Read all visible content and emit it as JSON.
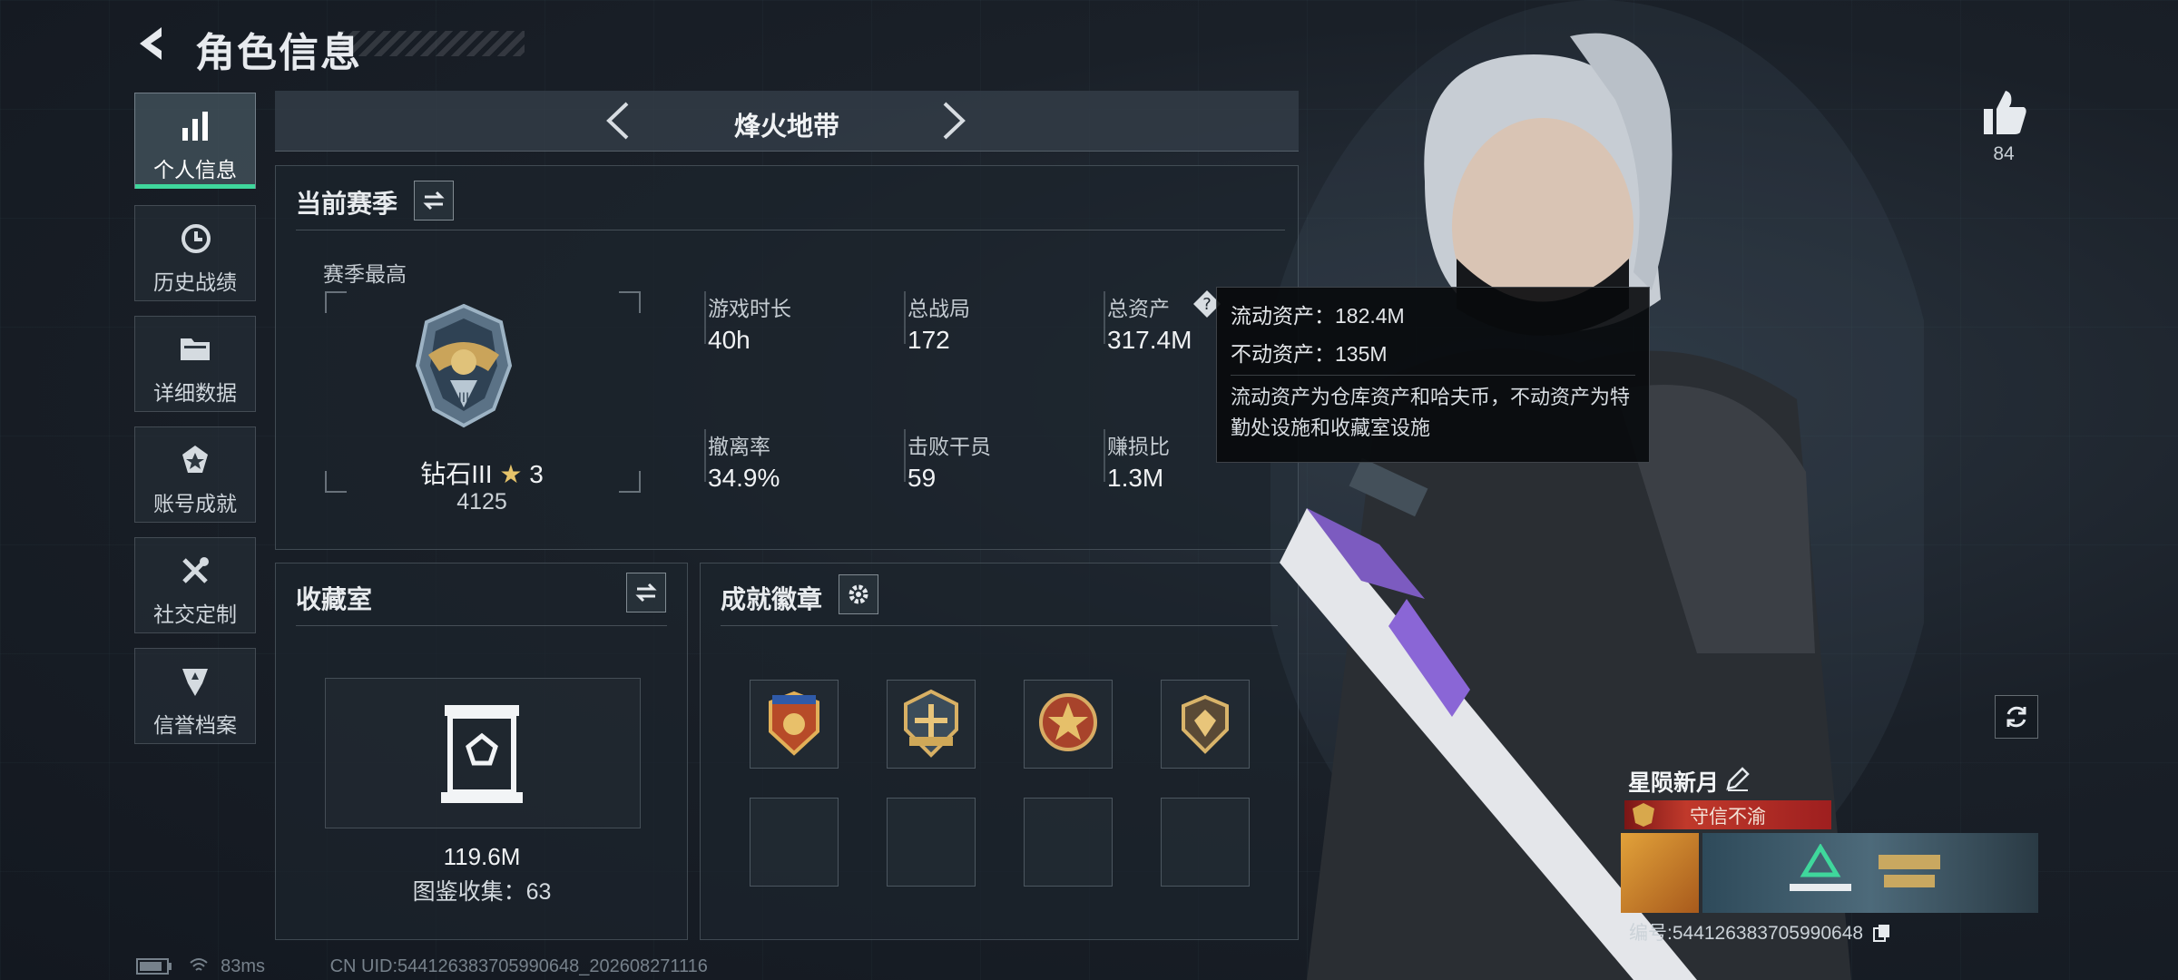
{
  "header": {
    "title": "角色信息"
  },
  "sidebar": {
    "items": [
      {
        "label": "个人信息",
        "active": true,
        "icon": "bar-chart-icon"
      },
      {
        "label": "历史战绩",
        "icon": "history-clock-icon"
      },
      {
        "label": "详细数据",
        "icon": "folder-icon"
      },
      {
        "label": "账号成就",
        "icon": "achievement-medal-icon"
      },
      {
        "label": "社交定制",
        "icon": "tools-icon"
      },
      {
        "label": "信誉档案",
        "icon": "shield-star-icon"
      }
    ]
  },
  "mode": {
    "title": "烽火地带"
  },
  "season": {
    "title": "当前赛季",
    "best_label": "赛季最高",
    "rank_name": "钻石III",
    "rank_stars": "3",
    "rank_score": "4125",
    "stats": [
      {
        "label": "游戏时长",
        "value": "40h"
      },
      {
        "label": "总战局",
        "value": "172"
      },
      {
        "label": "总资产",
        "value": "317.4M"
      },
      {
        "label": "撤离率",
        "value": "34.9%"
      },
      {
        "label": "击败干员",
        "value": "59"
      },
      {
        "label": "赚损比",
        "value": "1.3M"
      }
    ]
  },
  "tooltip": {
    "liquid": "流动资产：182.4M",
    "fixed": "不动资产：135M",
    "desc": "流动资产为仓库资产和哈夫币，不动资产为特勤处设施和收藏室设施"
  },
  "collection": {
    "title": "收藏室",
    "value": "119.6M",
    "count_text": "图鉴收集：63"
  },
  "badges": {
    "title": "成就徽章"
  },
  "profile": {
    "likes": "84",
    "player_name": "星陨新月",
    "title_text": "守信不渝",
    "id_text": "编号:544126383705990648"
  },
  "footer": {
    "ping": "83ms",
    "uid": "CN UID:544126383705990648_202608271116"
  },
  "colors": {
    "accent": "#3fd79c",
    "title_red": "#c0392b"
  }
}
